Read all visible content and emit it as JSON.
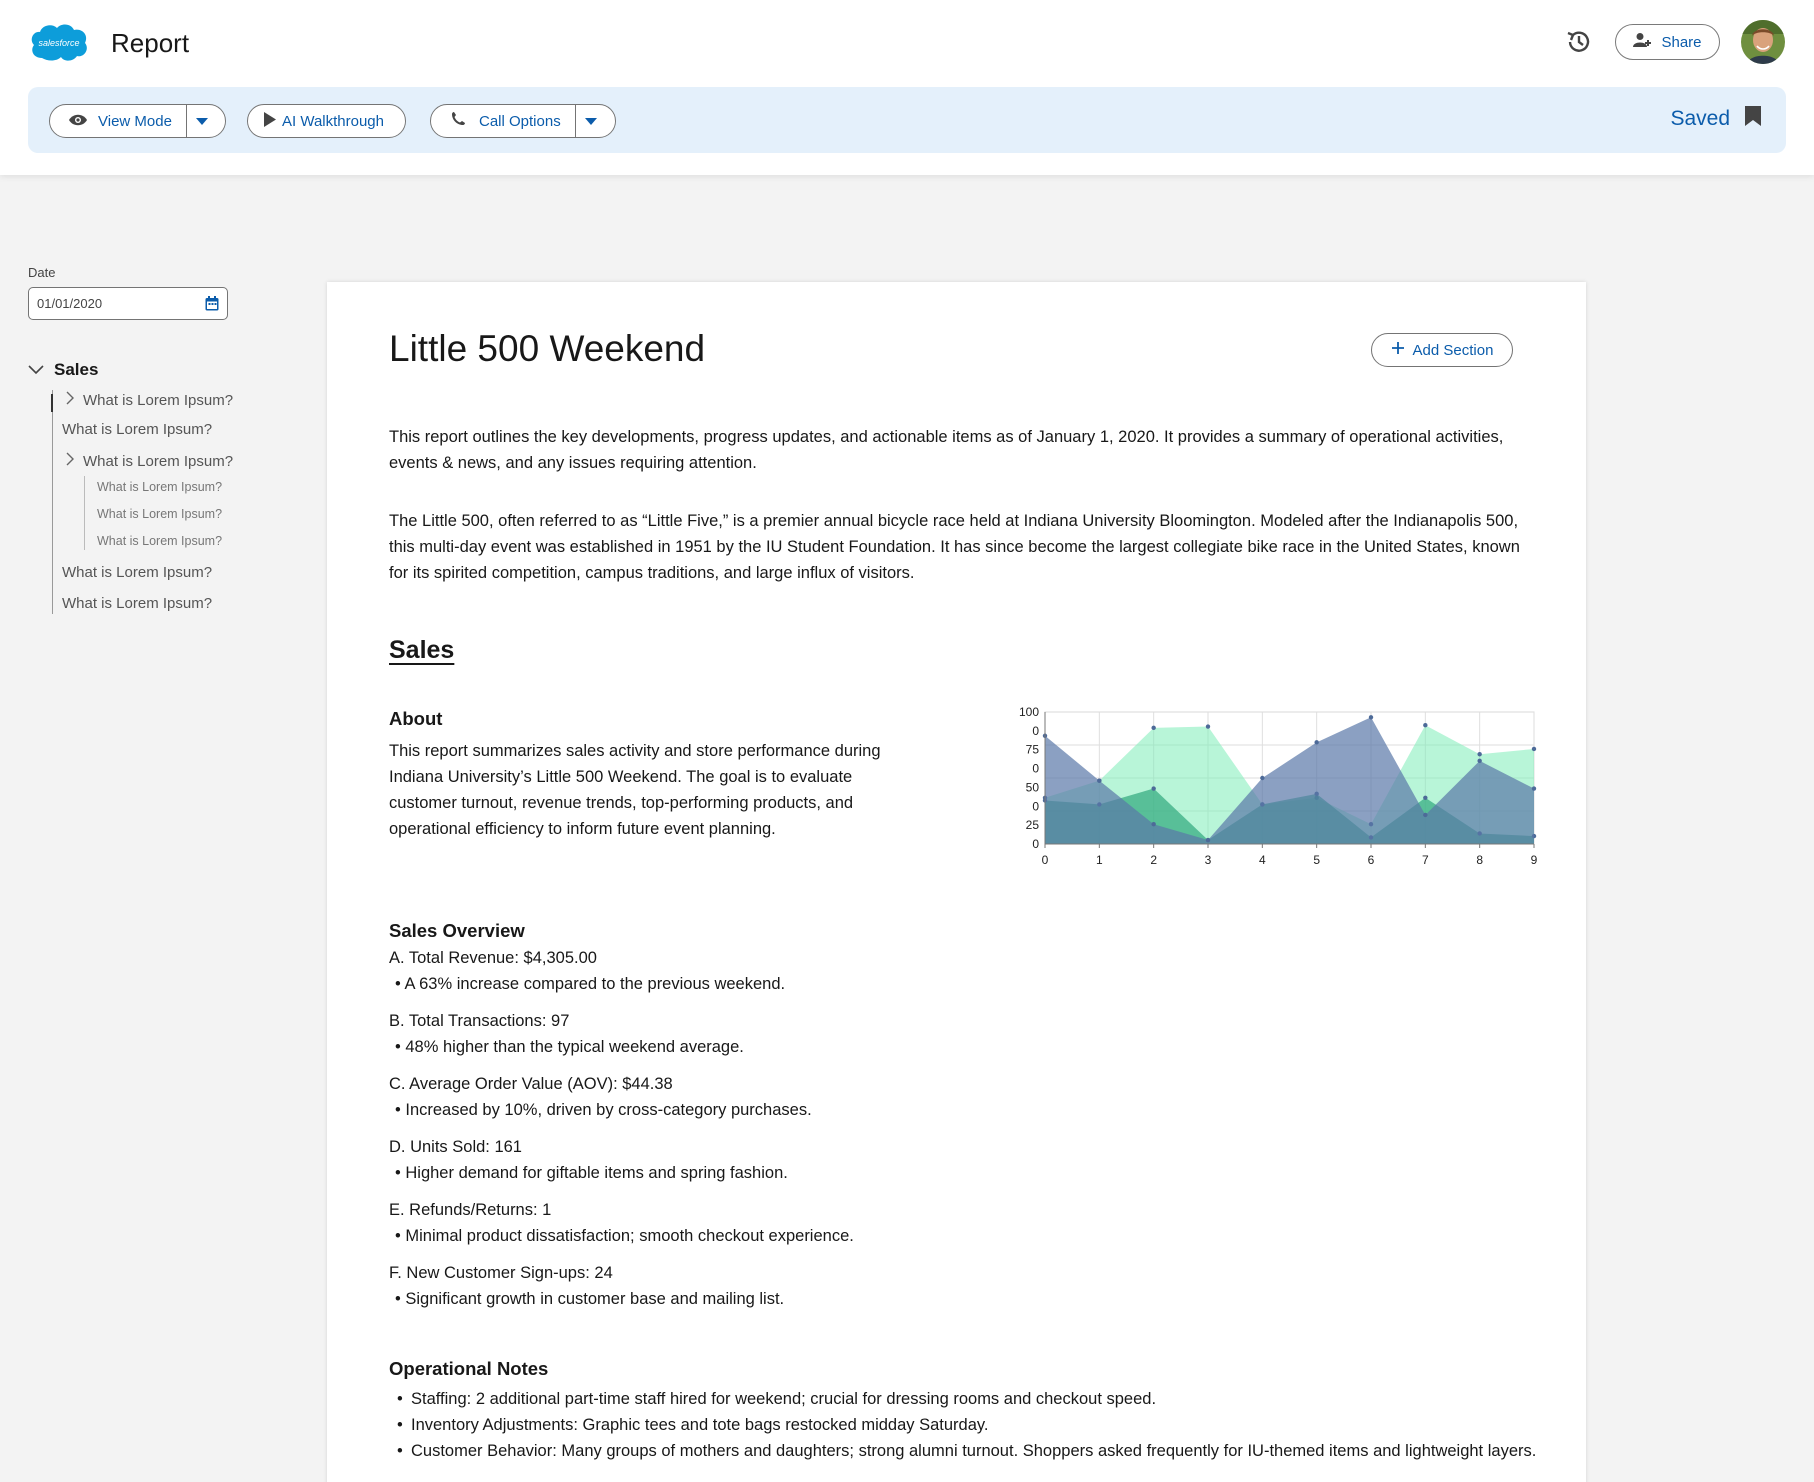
{
  "header": {
    "app_title": "Report",
    "logo_text": "salesforce",
    "share_label": "Share"
  },
  "toolbar": {
    "view_mode_label": "View Mode",
    "ai_walkthrough_label": "AI Walkthrough",
    "call_options_label": "Call Options",
    "saved_label": "Saved"
  },
  "sidebar": {
    "date_label": "Date",
    "date_value": "01/01/2020",
    "root_label": "Sales",
    "items": [
      {
        "label": "What is Lorem Ipsum?"
      },
      {
        "label": "What is Lorem Ipsum?"
      },
      {
        "label": "What is Lorem Ipsum?"
      },
      {
        "label": "What is Lorem Ipsum?"
      },
      {
        "label": "What is Lorem Ipsum?"
      },
      {
        "label": "What is Lorem Ipsum?"
      },
      {
        "label": "What is Lorem Ipsum?"
      },
      {
        "label": "What is Lorem Ipsum?"
      }
    ]
  },
  "doc": {
    "title": "Little 500 Weekend",
    "add_section_label": "Add Section",
    "intro": "This report outlines the key developments, progress updates, and actionable items as of January 1, 2020. It provides a summary of operational activities, events & news, and any issues requiring attention.",
    "background": "The Little 500, often referred to as “Little Five,” is a premier annual bicycle race held at Indiana University Bloomington. Modeled after the Indianapolis 500, this multi-day event was established in 1951 by the IU Student Foundation. It has since become the largest collegiate bike race in the United States, known for its spirited competition, campus traditions, and large influx of visitors.",
    "section_title": "Sales",
    "about_heading": "About",
    "about_text": "This report summarizes sales activity and store performance during Indiana University’s Little 500 Weekend. The goal is to evaluate customer turnout, revenue trends, top-performing products, and operational efficiency to inform future event planning.",
    "overview_heading": "Sales Overview",
    "overview": [
      {
        "item": "A. Total Revenue: $4,305.00",
        "note": "A 63% increase compared to the previous weekend."
      },
      {
        "item": "B. Total Transactions: 97",
        "note": "48% higher than the typical weekend average."
      },
      {
        "item": "C. Average Order Value (AOV): $44.38",
        "note": "Increased by 10%, driven by cross-category purchases."
      },
      {
        "item": "D. Units Sold: 161",
        "note": "Higher demand for giftable items and spring fashion."
      },
      {
        "item": "E. Refunds/Returns: 1",
        "note": "Minimal product dissatisfaction; smooth checkout experience."
      },
      {
        "item": "F. New Customer Sign-ups: 24",
        "note": "Significant growth in customer base and mailing list."
      }
    ],
    "ops_heading": "Operational Notes",
    "ops": [
      "Staffing: 2 additional part-time staff hired for weekend; crucial for dressing rooms and checkout speed.",
      "Inventory Adjustments: Graphic tees and tote bags restocked midday Saturday.",
      "Customer Behavior: Many groups of mothers and daughters; strong alumni turnout. Shoppers asked frequently for IU-themed items and lightweight layers."
    ]
  },
  "chart_data": {
    "type": "area",
    "x": [
      0,
      1,
      2,
      3,
      4,
      5,
      6,
      7,
      8,
      9
    ],
    "ytick_labels": [
      "0",
      "25",
      "0",
      "50",
      "0",
      "75",
      "0",
      "100"
    ],
    "ylim": [
      0,
      100
    ],
    "grid": true,
    "series": [
      {
        "color": "#7dedb8",
        "values": [
          35,
          48,
          88,
          89,
          30,
          35,
          15,
          90,
          68,
          72
        ]
      },
      {
        "color": "#2fa87e",
        "values": [
          33,
          30,
          42,
          3,
          30,
          38,
          5,
          35,
          8,
          6
        ]
      },
      {
        "color": "#5a77a8",
        "values": [
          82,
          48,
          15,
          3,
          50,
          77,
          96,
          22,
          63,
          42
        ]
      }
    ]
  }
}
